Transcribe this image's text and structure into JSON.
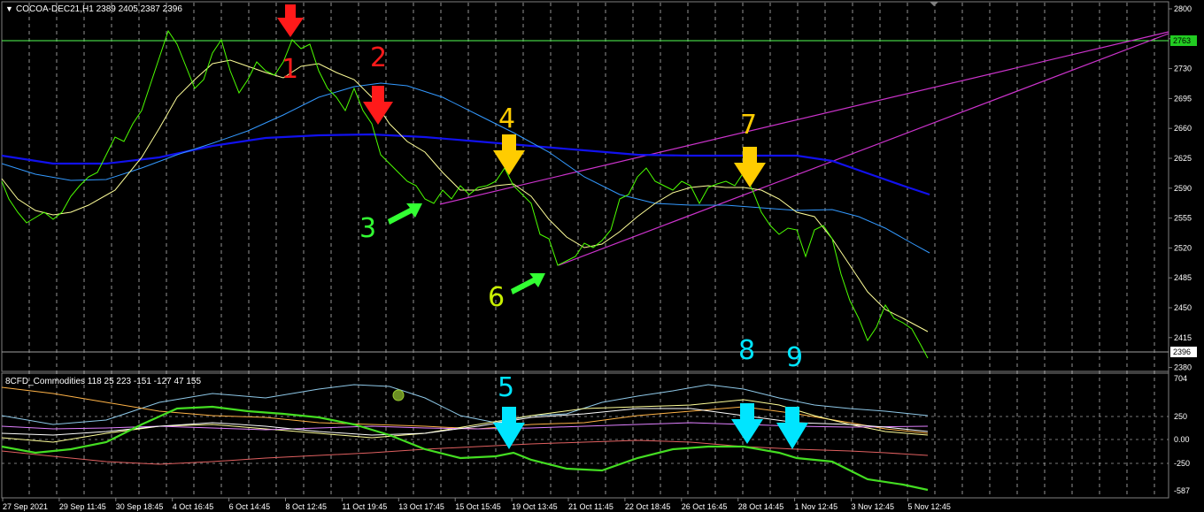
{
  "header": {
    "symbol_line": "COCOA-DEC21,H1  2389 2405 2387 2396",
    "indicator_line": "8CFD_Commodities 118 25 223 -151 -127 47 155"
  },
  "colors": {
    "background": "#000000",
    "price": "#4CFF00",
    "ma_fast": "#FFFF99",
    "ma_mid": "#3399FF",
    "ma_slow": "#0000EE",
    "trendline": "#CC33CC",
    "hline": "#55FF55",
    "arrow_red": "#FF1A1A",
    "arrow_yellow": "#FFCC00",
    "arrow_green": "#33FF33",
    "arrow_cyan": "#00E5FF",
    "grid": "#D0D0D0"
  },
  "price_axis": {
    "ticks": [
      "2800",
      "2765",
      "2730",
      "2695",
      "2660",
      "2625",
      "2590",
      "2555",
      "2520",
      "2485",
      "2450",
      "2415",
      "2380"
    ],
    "hline_label": "2763",
    "last_price_label": "2396"
  },
  "indicator_axis": {
    "ticks": [
      "704",
      "250",
      "0.00",
      "-250",
      "-587"
    ]
  },
  "time_axis": {
    "labels": [
      "27 Sep 2021",
      "29 Sep 11:45",
      "30 Sep 18:45",
      "4 Oct 16:45",
      "6 Oct 14:45",
      "8 Oct 12:45",
      "11 Oct 19:45",
      "13 Oct 17:45",
      "15 Oct 15:45",
      "19 Oct 13:45",
      "21 Oct 11:45",
      "22 Oct 18:45",
      "26 Oct 16:45",
      "28 Oct 14:45",
      "1 Nov 12:45",
      "3 Nov 12:45",
      "5 Nov 12:45"
    ]
  },
  "annotations": [
    {
      "text": "1",
      "color": "arrow_red"
    },
    {
      "text": "2",
      "color": "arrow_red"
    },
    {
      "text": "3",
      "color": "arrow_green"
    },
    {
      "text": "4",
      "color": "arrow_yellow"
    },
    {
      "text": "5",
      "color": "arrow_cyan"
    },
    {
      "text": "6",
      "color": "arrow_green"
    },
    {
      "text": "7",
      "color": "arrow_yellow"
    },
    {
      "text": "8",
      "color": "arrow_cyan"
    },
    {
      "text": "9",
      "color": "arrow_cyan"
    }
  ],
  "chart_data": {
    "type": "line",
    "title": "COCOA-DEC21,H1",
    "ohlc_last": {
      "open": 2389,
      "high": 2405,
      "low": 2387,
      "close": 2396
    },
    "y_range": [
      2380,
      2800
    ],
    "horizontal_line": 2763,
    "x": [
      "27 Sep 2021",
      "29 Sep 11:45",
      "30 Sep 18:45",
      "4 Oct 16:45",
      "6 Oct 14:45",
      "8 Oct 12:45",
      "11 Oct 19:45",
      "13 Oct 17:45",
      "15 Oct 15:45",
      "19 Oct 13:45",
      "21 Oct 11:45",
      "22 Oct 18:45",
      "26 Oct 16:45",
      "28 Oct 14:45",
      "1 Nov 12:45",
      "3 Nov 12:45",
      "5 Nov 12:45"
    ],
    "series": [
      {
        "values": [
          2590,
          2560,
          2590,
          2620,
          2750,
          2720,
          2735,
          2760,
          2730,
          2700,
          2640,
          2580,
          2585,
          2595,
          2520,
          2500,
          2560,
          2590,
          2615,
          2595,
          2590,
          2545,
          2530,
          2460,
          2445,
          2400
        ]
      },
      {
        "values": [
          2585,
          2560,
          2565,
          2600,
          2690,
          2730,
          2740,
          2735,
          2720,
          2690,
          2650,
          2615,
          2595,
          2600,
          2580,
          2540,
          2540,
          2580,
          2595,
          2597,
          2585,
          2560,
          2530,
          2480,
          2445,
          2420
        ]
      },
      {
        "values": [
          2595,
          2600,
          2605,
          2625,
          2650,
          2675,
          2700,
          2712,
          2710,
          2695,
          2660,
          2630,
          2605,
          2590,
          2575,
          2565,
          2565,
          2570,
          2575,
          2570,
          2565,
          2560,
          2550,
          2540,
          2535,
          2515
        ]
      },
      {
        "values": [
          2628,
          2622,
          2620,
          2625,
          2635,
          2645,
          2650,
          2652,
          2652,
          2650,
          2648,
          2645,
          2640,
          2635,
          2633,
          2630,
          2628,
          2626,
          2625,
          2625,
          2625,
          2624,
          2615,
          2605,
          2595,
          2585
        ]
      }
    ],
    "trendlines": [
      {
        "from": [
          "13 Oct 17:45",
          2570
        ],
        "to": [
          "5 Nov 12:45",
          2705
        ]
      },
      {
        "from": [
          "21 Oct 11:45",
          2500
        ],
        "to": [
          "5 Nov 12:45",
          2680
        ]
      }
    ],
    "indicator": {
      "name": "8CFD_Commodities",
      "current_values": [
        118,
        25,
        223,
        -151,
        -127,
        47,
        155
      ],
      "y_range": [
        -587,
        704
      ]
    }
  }
}
